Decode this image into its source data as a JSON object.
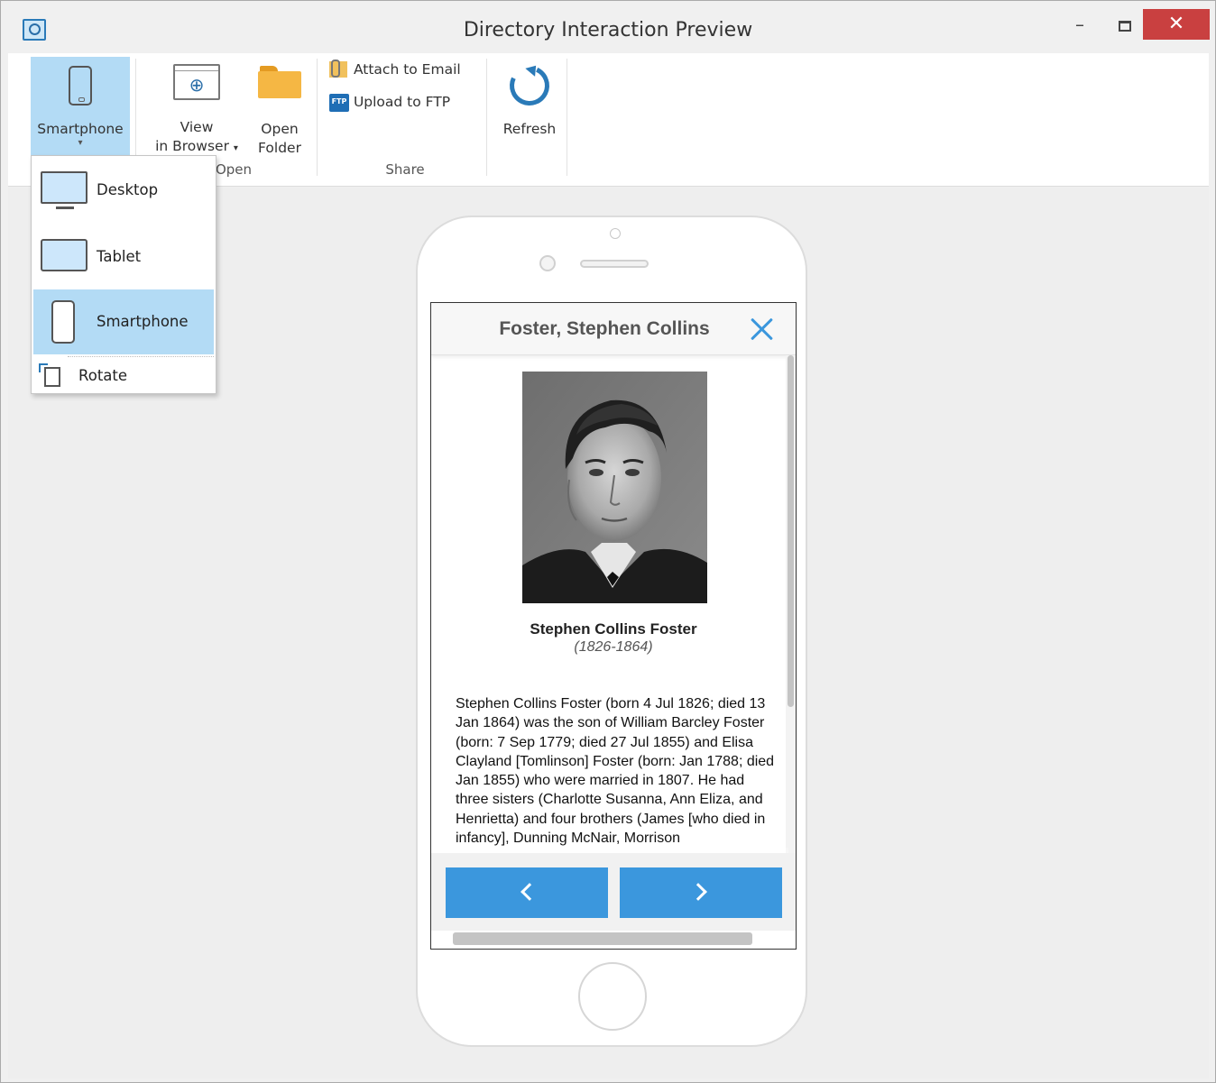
{
  "window": {
    "title": "Directory Interaction Preview",
    "minimize": "–",
    "close": "✕"
  },
  "ribbon": {
    "device_button": {
      "label": "Smartphone",
      "arrow": "▾"
    },
    "view_in_browser": {
      "line1": "View",
      "line2": "in Browser",
      "arrow": "▾"
    },
    "open_folder": {
      "line1": "Open",
      "line2": "Folder"
    },
    "open_group_label": "Open",
    "attach_email": "Attach to Email",
    "upload_ftp": "Upload to FTP",
    "ftp_badge": "FTP",
    "share_group_label": "Share",
    "refresh": "Refresh"
  },
  "device_menu": {
    "items": [
      {
        "label": "Desktop",
        "icon": "desktop-icon",
        "selected": false
      },
      {
        "label": "Tablet",
        "icon": "tablet-icon",
        "selected": false
      },
      {
        "label": "Smartphone",
        "icon": "smartphone-icon",
        "selected": true
      }
    ],
    "rotate": "Rotate"
  },
  "preview": {
    "header_title": "Foster, Stephen Collins",
    "person_name": "Stephen Collins Foster",
    "person_dates": "(1826-1864)",
    "bio": "Stephen Collins Foster (born 4 Jul 1826; died 13 Jan 1864) was the son of William Barcley Foster (born: 7 Sep 1779; died 27 Jul 1855) and Elisa Clayland [Tomlinson] Foster (born: Jan 1788; died Jan 1855) who were married in 1807. He had three sisters (Charlotte Susanna, Ann Eliza, and Henrietta) and four brothers (James [who died in infancy], Dunning McNair, Morrison"
  },
  "colors": {
    "accent": "#3b97dd",
    "selected": "#b3dbf5",
    "close_button": "#c94040"
  }
}
